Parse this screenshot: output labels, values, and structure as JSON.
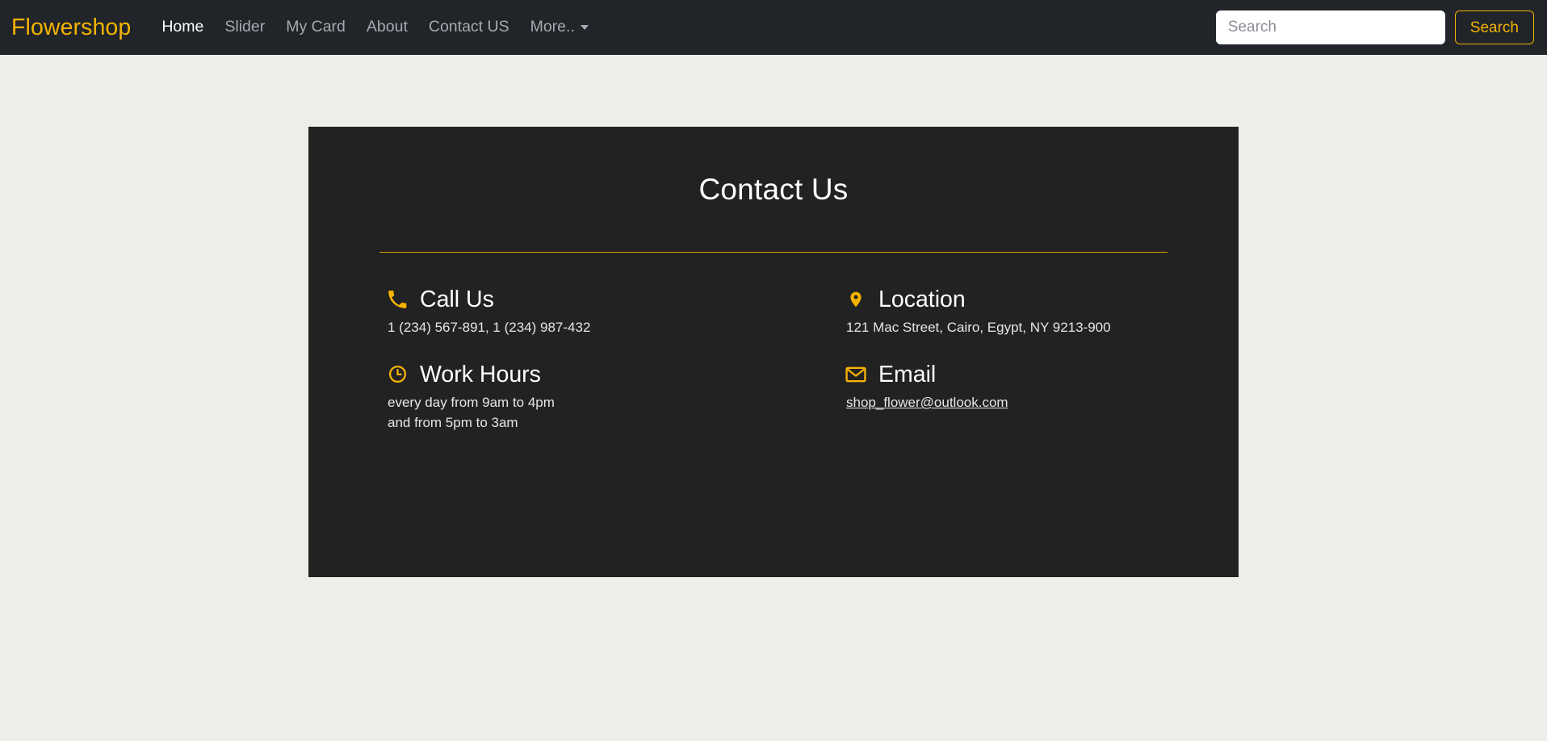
{
  "colors": {
    "accent": "#f5b301",
    "navbar_bg": "#212529",
    "card_bg": "#222222",
    "page_bg": "#efedea",
    "divider": "#d9a200",
    "muted_link": "#a7aab0",
    "active_link": "#ffffff"
  },
  "navbar": {
    "brand": "Flowershop",
    "items": [
      {
        "label": "Home",
        "active": true
      },
      {
        "label": "Slider",
        "active": false
      },
      {
        "label": "My Card",
        "active": false
      },
      {
        "label": "About",
        "active": false
      },
      {
        "label": "Contact US",
        "active": false
      },
      {
        "label": "More..",
        "active": false,
        "icon": "chevron-down-icon"
      }
    ],
    "search": {
      "placeholder": "Search",
      "value": "",
      "button_label": "Search"
    }
  },
  "contact": {
    "title": "Contact Us",
    "call": {
      "icon": "phone-icon",
      "title": "Call Us",
      "text": "1 (234) 567-891, 1 (234) 987-432"
    },
    "location": {
      "icon": "map-pin-icon",
      "title": "Location",
      "text": "121 Mac Street, Cairo, Egypt, NY 9213-900"
    },
    "hours": {
      "icon": "clock-icon",
      "title": "Work Hours",
      "line1": "every day from 9am to 4pm",
      "line2": "and from 5pm to 3am"
    },
    "email": {
      "icon": "envelope-icon",
      "title": "Email",
      "address": "shop_flower@outlook.com"
    }
  }
}
